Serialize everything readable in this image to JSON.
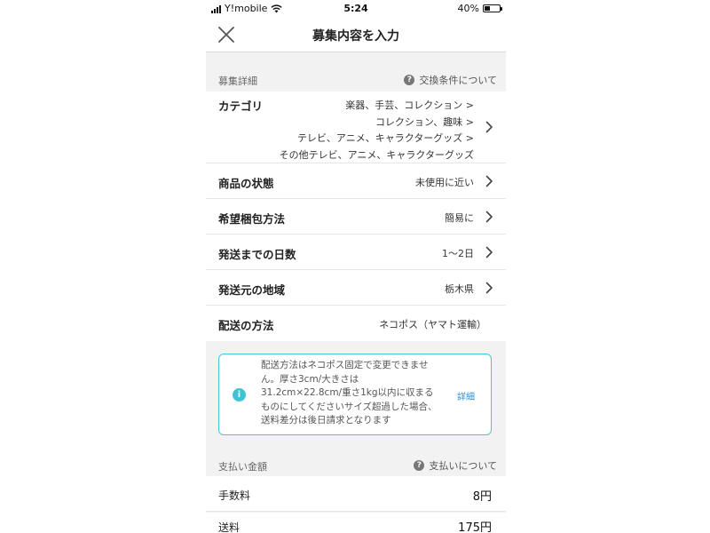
{
  "status_bar": {
    "carrier": "Y!mobile",
    "time": "5:24",
    "battery": "40%",
    "battery_level": 0.4
  },
  "nav": {
    "title": "募集内容を入力",
    "close_icon": "close-icon"
  },
  "details_section": {
    "label": "募集詳細",
    "link": "交換条件について"
  },
  "rows": {
    "category": {
      "label": "カテゴリ",
      "lines": [
        "楽器、手芸、コレクション >",
        "コレクション、趣味 >",
        "テレビ、アニメ、キャラクターグッズ >",
        "その他テレビ、アニメ、キャラクターグッズ"
      ]
    },
    "condition": {
      "label": "商品の状態",
      "value": "未使用に近い"
    },
    "packing": {
      "label": "希望梱包方法",
      "value": "簡易に"
    },
    "days": {
      "label": "発送までの日数",
      "value": "1〜2日"
    },
    "region": {
      "label": "発送元の地域",
      "value": "栃木県"
    },
    "shipping_method": {
      "label": "配送の方法",
      "value": "ネコポス（ヤマト運輸）"
    }
  },
  "info": {
    "text": "配送方法はネコポス固定で変更できません。厚さ3cm/大きさは31.2cm×22.8cm/重さ1kg以内に収まるものにしてくださいサイズ超過した場合、送料差分は後日請求となります",
    "lines": [
      "配送方法はネコポス固定で変更できませ",
      "ん。厚さ3cm/大きさは",
      "31.2cm×22.8cm/重さ1kg以内に収まる",
      "ものにしてくださいサイズ超過した場合、",
      "送料差分は後日請求となります"
    ],
    "link": "詳細",
    "accent": "#48c5d6"
  },
  "payment_section": {
    "label": "支払い金額",
    "link": "支払いについて"
  },
  "payment": {
    "fee": {
      "label": "手数料",
      "value": "8円"
    },
    "shipping": {
      "label": "送料",
      "value": "175円"
    }
  }
}
